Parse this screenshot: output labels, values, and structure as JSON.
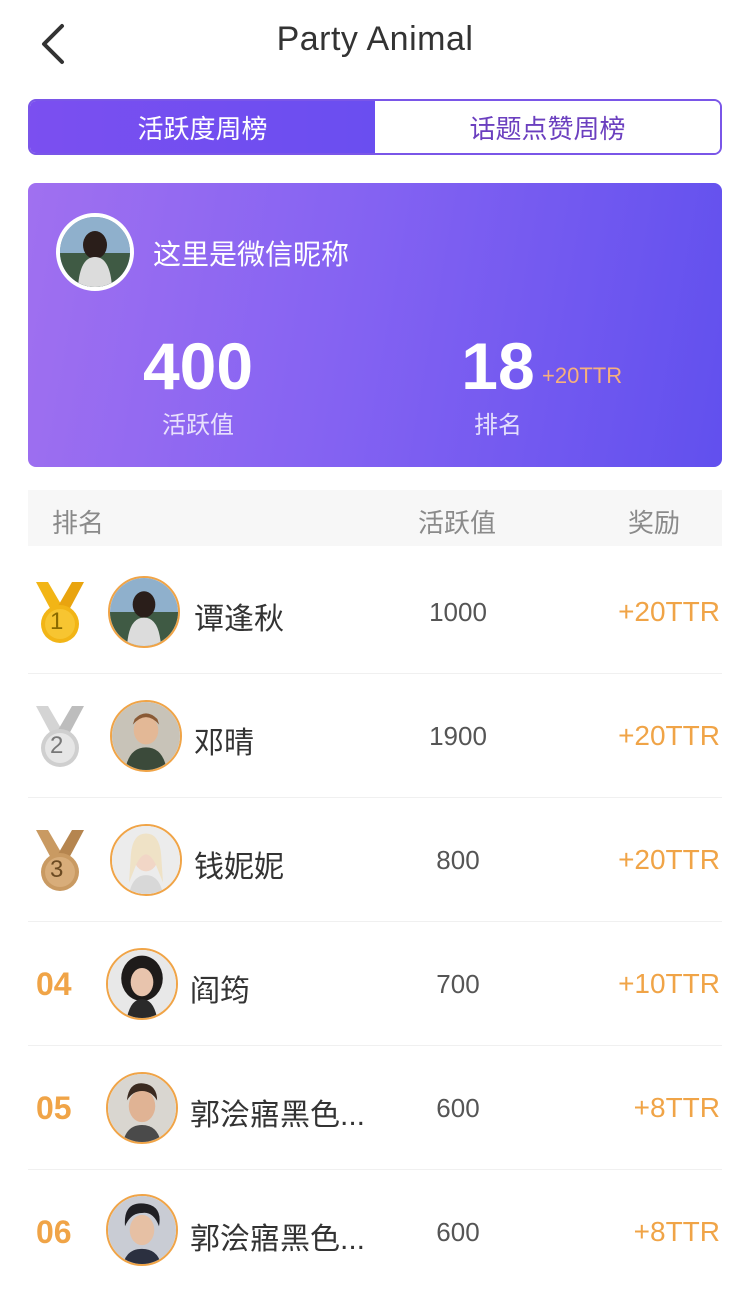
{
  "header": {
    "title": "Party Animal",
    "back_icon": "chevron-left-icon"
  },
  "tabs": [
    {
      "label": "活跃度周榜",
      "active": true
    },
    {
      "label": "话题点赞周榜",
      "active": false
    }
  ],
  "profile": {
    "nickname": "这里是微信昵称",
    "active_value": "400",
    "active_label": "活跃值",
    "rank_value": "18",
    "rank_label": "排名",
    "reward": "+20TTR"
  },
  "table": {
    "headers": {
      "rank": "排名",
      "value": "活跃值",
      "reward": "奖励"
    },
    "rows": [
      {
        "rank": "1",
        "medal": "gold",
        "name": "谭逢秋",
        "value": "1000",
        "reward": "+20TTR"
      },
      {
        "rank": "2",
        "medal": "silver",
        "name": "邓晴",
        "value": "1900",
        "reward": "+20TTR"
      },
      {
        "rank": "3",
        "medal": "bronze",
        "name": "钱妮妮",
        "value": "800",
        "reward": "+20TTR"
      },
      {
        "rank": "04",
        "medal": null,
        "name": "阎筠",
        "value": "700",
        "reward": "+10TTR"
      },
      {
        "rank": "05",
        "medal": null,
        "name": "郭浍寤黑色...",
        "value": "600",
        "reward": "+8TTR"
      },
      {
        "rank": "06",
        "medal": null,
        "name": "郭浍寤黑色...",
        "value": "600",
        "reward": "+8TTR"
      }
    ]
  },
  "colors": {
    "accent": "#7a56e8",
    "reward": "#f0a447",
    "gold": "#f2b516",
    "silver": "#cfcfcf",
    "bronze": "#c99a62"
  }
}
